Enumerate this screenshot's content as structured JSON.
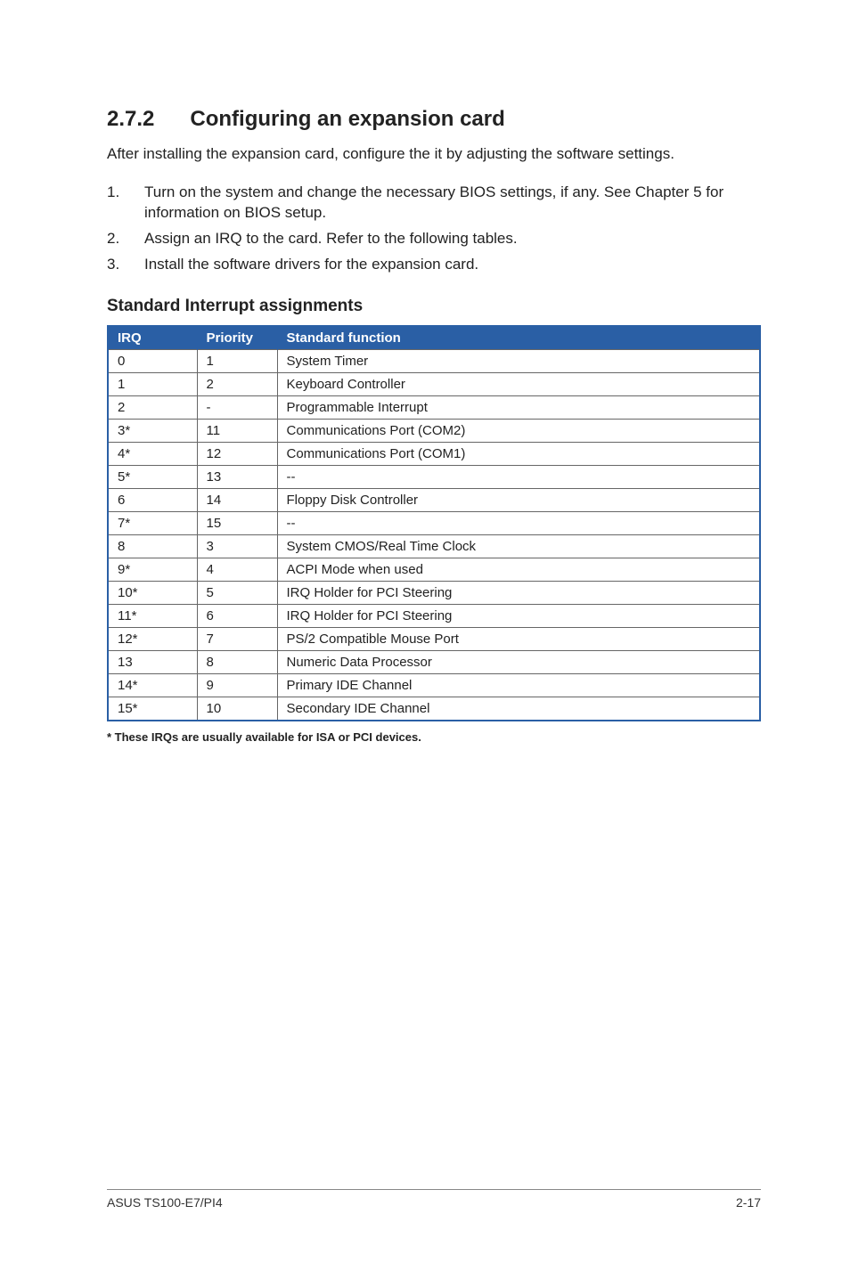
{
  "section": {
    "number": "2.7.2",
    "title": "Configuring an expansion card"
  },
  "intro": "After installing the expansion card, configure the it by adjusting the software settings.",
  "steps": [
    {
      "n": "1.",
      "t": "Turn on the system and change the necessary BIOS settings, if any. See Chapter 5 for information on BIOS setup."
    },
    {
      "n": "2.",
      "t": "Assign an IRQ to the card. Refer to the following tables."
    },
    {
      "n": "3.",
      "t": "Install the software drivers for the expansion card."
    }
  ],
  "subhead": "Standard Interrupt assignments",
  "table": {
    "headers": {
      "irq": "IRQ",
      "priority": "Priority",
      "func": "Standard function"
    },
    "rows": [
      {
        "irq": "0",
        "priority": "1",
        "func": "System Timer"
      },
      {
        "irq": "1",
        "priority": "2",
        "func": "Keyboard Controller"
      },
      {
        "irq": "2",
        "priority": "-",
        "func": "Programmable Interrupt"
      },
      {
        "irq": "3*",
        "priority": "11",
        "func": "Communications Port (COM2)"
      },
      {
        "irq": "4*",
        "priority": "12",
        "func": "Communications Port (COM1)"
      },
      {
        "irq": "5*",
        "priority": "13",
        "func": "--"
      },
      {
        "irq": "6",
        "priority": "14",
        "func": "Floppy Disk Controller"
      },
      {
        "irq": "7*",
        "priority": "15",
        "func": "--"
      },
      {
        "irq": "8",
        "priority": "3",
        "func": "System CMOS/Real Time Clock"
      },
      {
        "irq": "9*",
        "priority": "4",
        "func": "ACPI Mode when used"
      },
      {
        "irq": "10*",
        "priority": "5",
        "func": "IRQ Holder for PCI Steering"
      },
      {
        "irq": "11*",
        "priority": "6",
        "func": "IRQ Holder for PCI Steering"
      },
      {
        "irq": "12*",
        "priority": "7",
        "func": "PS/2 Compatible Mouse Port"
      },
      {
        "irq": "13",
        "priority": "8",
        "func": "Numeric Data Processor"
      },
      {
        "irq": "14*",
        "priority": "9",
        "func": "Primary IDE Channel"
      },
      {
        "irq": "15*",
        "priority": "10",
        "func": "Secondary IDE Channel"
      }
    ]
  },
  "footnote": "* These IRQs are usually available for ISA or PCI devices.",
  "footer": {
    "left": "ASUS TS100-E7/PI4",
    "right": "2-17"
  }
}
